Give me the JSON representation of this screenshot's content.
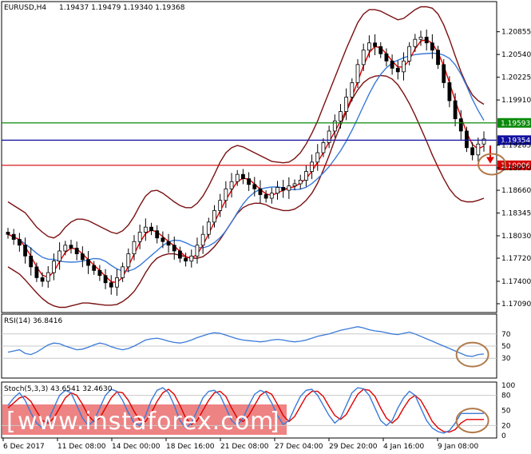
{
  "header": {
    "symbol": "EURUSD,H4",
    "ohlc": "1.19437 1.19479 1.19340 1.19368"
  },
  "chart_data": [
    {
      "type": "candlestick",
      "title": "EURUSD,H4",
      "yticks": [
        "1.20855",
        "1.20540",
        "1.20225",
        "1.19910",
        "1.19285",
        "1.18970",
        "1.18660",
        "1.18345",
        "1.18030",
        "1.17720",
        "1.17400",
        "1.17090"
      ],
      "ylim": [
        1.1699,
        1.2125
      ],
      "levels": [
        {
          "label": "1.19593",
          "value": 1.19593,
          "color": "#0a8a0a"
        },
        {
          "label": "1.19354",
          "value": 1.19354,
          "color": "#1010a0"
        },
        {
          "label": "1.19006",
          "value": 1.19006,
          "color": "#d40000"
        }
      ],
      "close_series": [
        1.1805,
        1.1798,
        1.179,
        1.1775,
        1.176,
        1.1745,
        1.174,
        1.1752,
        1.1768,
        1.1782,
        1.179,
        1.1786,
        1.1778,
        1.177,
        1.1762,
        1.1755,
        1.1748,
        1.1738,
        1.1732,
        1.1745,
        1.176,
        1.1778,
        1.1795,
        1.1808,
        1.1815,
        1.181,
        1.18,
        1.1795,
        1.179,
        1.1782,
        1.1772,
        1.1768,
        1.1775,
        1.179,
        1.1805,
        1.1822,
        1.1838,
        1.1852,
        1.1868,
        1.1878,
        1.1888,
        1.1882,
        1.1874,
        1.1868,
        1.186,
        1.1855,
        1.1862,
        1.187,
        1.1866,
        1.1872,
        1.1875,
        1.188,
        1.1892,
        1.1905,
        1.1918,
        1.1932,
        1.1948,
        1.1962,
        1.1975,
        1.1995,
        1.2015,
        1.204,
        1.206,
        1.207,
        1.2065,
        1.2055,
        1.2045,
        1.2035,
        1.203,
        1.2045,
        1.2065,
        1.2075,
        1.2078,
        1.207,
        1.206,
        1.204,
        1.2015,
        1.199,
        1.1965,
        1.1948,
        1.1925,
        1.1915,
        1.193,
        1.1937
      ],
      "upper_band": [
        1.185,
        1.1845,
        1.184,
        1.1835,
        1.1825,
        1.1815,
        1.1808,
        1.1802,
        1.18,
        1.1805,
        1.1815,
        1.1822,
        1.1826,
        1.1826,
        1.1824,
        1.182,
        1.1816,
        1.1812,
        1.1808,
        1.1806,
        1.181,
        1.1818,
        1.183,
        1.1845,
        1.1858,
        1.1865,
        1.1866,
        1.1862,
        1.1856,
        1.185,
        1.1845,
        1.1842,
        1.1842,
        1.1848,
        1.1858,
        1.1872,
        1.1888,
        1.1905,
        1.1918,
        1.1925,
        1.1928,
        1.1926,
        1.1922,
        1.1918,
        1.1914,
        1.191,
        1.1906,
        1.1905,
        1.1904,
        1.1905,
        1.191,
        1.1918,
        1.193,
        1.1945,
        1.1962,
        1.1982,
        1.2002,
        1.2022,
        1.2042,
        1.2062,
        1.208,
        1.2098,
        1.211,
        1.2116,
        1.2116,
        1.2114,
        1.211,
        1.2106,
        1.2102,
        1.2104,
        1.211,
        1.2116,
        1.212,
        1.212,
        1.2118,
        1.211,
        1.2095,
        1.2075,
        1.2052,
        1.203,
        1.2012,
        1.1998,
        1.199,
        1.1985
      ],
      "lower_band": [
        1.176,
        1.1755,
        1.175,
        1.1742,
        1.1733,
        1.1724,
        1.1716,
        1.171,
        1.1706,
        1.1704,
        1.1704,
        1.1706,
        1.1708,
        1.171,
        1.171,
        1.1709,
        1.1708,
        1.1707,
        1.1707,
        1.1708,
        1.1712,
        1.1718,
        1.1726,
        1.1738,
        1.1752,
        1.1764,
        1.1772,
        1.1776,
        1.1778,
        1.1778,
        1.1776,
        1.1774,
        1.1772,
        1.1772,
        1.1774,
        1.178,
        1.1788,
        1.1798,
        1.181,
        1.1822,
        1.1834,
        1.1842,
        1.1846,
        1.1848,
        1.1848,
        1.1846,
        1.1842,
        1.184,
        1.1838,
        1.1838,
        1.184,
        1.1845,
        1.1852,
        1.1862,
        1.1876,
        1.1894,
        1.1914,
        1.1936,
        1.1956,
        1.1975,
        1.1992,
        1.2005,
        1.2015,
        1.2021,
        1.2024,
        1.2025,
        1.2024,
        1.202,
        1.2012,
        1.2,
        1.1986,
        1.197,
        1.1952,
        1.1934,
        1.1915,
        1.1898,
        1.1882,
        1.1868,
        1.1858,
        1.1852,
        1.185,
        1.185,
        1.1852,
        1.1855
      ]
    },
    {
      "type": "line",
      "title": "RSI(14) 36.8416",
      "yticks": [
        "70",
        "50",
        "30"
      ],
      "ylim": [
        0,
        100
      ],
      "values": [
        40,
        42,
        44,
        38,
        36,
        40,
        46,
        52,
        55,
        54,
        50,
        47,
        44,
        45,
        48,
        52,
        55,
        53,
        49,
        46,
        44,
        46,
        50,
        55,
        60,
        62,
        63,
        61,
        58,
        56,
        55,
        57,
        60,
        64,
        67,
        70,
        72,
        71,
        68,
        65,
        62,
        60,
        59,
        58,
        57,
        58,
        60,
        61,
        60,
        58,
        57,
        58,
        60,
        63,
        66,
        68,
        70,
        73,
        76,
        78,
        80,
        82,
        80,
        77,
        75,
        74,
        72,
        70,
        69,
        71,
        73,
        70,
        66,
        62,
        58,
        54,
        50,
        46,
        42,
        38,
        34,
        33,
        36,
        37
      ]
    },
    {
      "type": "line",
      "title": "Stoch(5,3,3) 43.6541 32.4630",
      "yticks": [
        "100",
        "80",
        "50",
        "20",
        "0"
      ],
      "ylim": [
        0,
        100
      ],
      "k_values": [
        60,
        75,
        85,
        70,
        45,
        25,
        15,
        30,
        55,
        80,
        90,
        85,
        60,
        35,
        20,
        30,
        55,
        80,
        92,
        88,
        70,
        45,
        25,
        20,
        40,
        70,
        90,
        95,
        85,
        60,
        30,
        15,
        25,
        50,
        75,
        88,
        90,
        80,
        55,
        30,
        20,
        35,
        60,
        82,
        90,
        85,
        65,
        40,
        22,
        30,
        55,
        78,
        90,
        92,
        80,
        60,
        40,
        25,
        35,
        60,
        85,
        95,
        93,
        80,
        55,
        30,
        20,
        30,
        55,
        75,
        88,
        80,
        55,
        30,
        15,
        8,
        5,
        10,
        25,
        44,
        44,
        44,
        44,
        44
      ],
      "d_values": [
        55,
        65,
        75,
        78,
        68,
        48,
        30,
        25,
        35,
        55,
        75,
        85,
        80,
        62,
        40,
        28,
        35,
        55,
        75,
        87,
        85,
        70,
        48,
        30,
        28,
        45,
        68,
        85,
        92,
        82,
        60,
        35,
        22,
        30,
        50,
        70,
        85,
        88,
        78,
        55,
        35,
        28,
        40,
        60,
        80,
        88,
        82,
        62,
        40,
        28,
        38,
        58,
        78,
        88,
        88,
        78,
        58,
        40,
        32,
        42,
        62,
        82,
        92,
        90,
        78,
        55,
        35,
        25,
        35,
        55,
        72,
        80,
        70,
        50,
        28,
        15,
        8,
        7,
        12,
        25,
        32,
        32,
        32,
        32
      ]
    }
  ],
  "time_axis": [
    "6 Dec 2017",
    "11 Dec 08:00",
    "14 Dec 00:00",
    "18 Dec 16:00",
    "21 Dec 08:00",
    "27 Dec 04:00",
    "29 Dec 20:00",
    "4 Jan 16:00",
    "9 Jan 08:00"
  ],
  "watermark": "www.instaforex.com",
  "colors": {
    "price": "#000000",
    "bollinger": "#7a1010",
    "ma_fast": "#e00000",
    "ma_slow": "#3a7ad8",
    "rsi": "#3a7ad8",
    "stoch_k": "#3a7ad8",
    "stoch_d": "#e00000",
    "annotation": "#b07a4a"
  }
}
